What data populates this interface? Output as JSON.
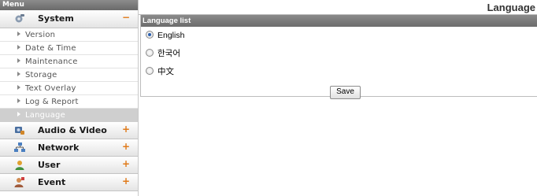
{
  "sidebar": {
    "header": "Menu",
    "sections": [
      {
        "label": "System",
        "toggle": "−",
        "icon": "gear-icon",
        "items": [
          "Version",
          "Date & Time",
          "Maintenance",
          "Storage",
          "Text Overlay",
          "Log & Report",
          "Language"
        ],
        "active_item": "Language"
      },
      {
        "label": "Audio & Video",
        "toggle": "+",
        "icon": "camera-icon"
      },
      {
        "label": "Network",
        "toggle": "+",
        "icon": "network-icon"
      },
      {
        "label": "User",
        "toggle": "+",
        "icon": "user-icon"
      },
      {
        "label": "Event",
        "toggle": "+",
        "icon": "event-icon"
      }
    ]
  },
  "page": {
    "title": "Language"
  },
  "language_panel": {
    "header": "Language list",
    "options": [
      "English",
      "한국어",
      "中文"
    ],
    "selected": "English",
    "save_label": "Save"
  },
  "colors": {
    "accent": "#e07a1a",
    "header_gray": "#7a7a7a",
    "active_item_bg": "#cfcfcf",
    "radio_fill": "#2a5fb0"
  }
}
